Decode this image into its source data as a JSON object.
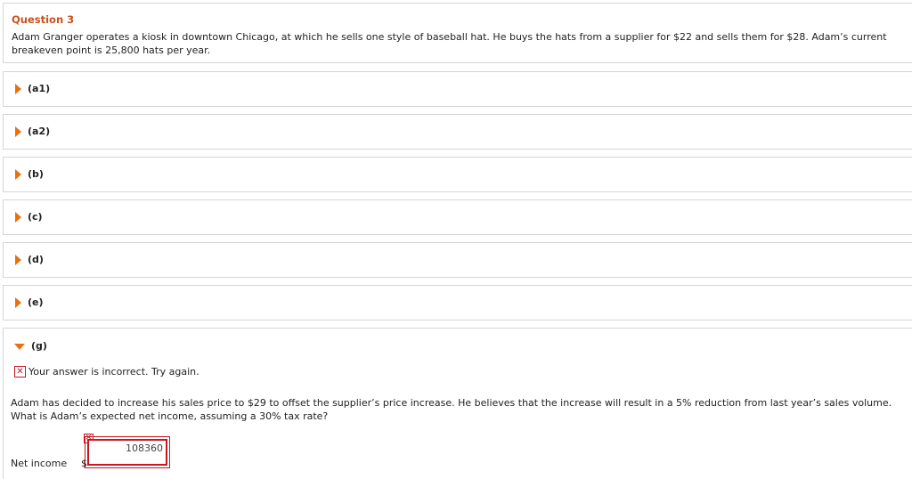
{
  "question": {
    "title": "Question 3",
    "text": "Adam Granger operates a kiosk in downtown Chicago, at which he sells one style of baseball hat. He buys the hats from a supplier for $22 and sells them for $28. Adam’s current breakeven point is 25,800 hats per year."
  },
  "parts": {
    "a1": "(a1)",
    "a2": "(a2)",
    "b": "(b)",
    "c": "(c)",
    "d": "(d)",
    "e": "(e)",
    "g": "(g)"
  },
  "part_g": {
    "feedback": "Your answer is incorrect.  Try again.",
    "text": "Adam has decided to increase his sales price to $29 to offset the supplier’s price increase. He believes that the increase will result in a 5% reduction from last year’s sales volume. What is Adam’s expected net income, assuming a 30% tax rate?",
    "net_income_label": "Net income",
    "currency": "$",
    "answer_value": "108360",
    "incorrect_mark": "✕"
  },
  "icons": {
    "collapsed": "triangle-right-icon",
    "expanded": "triangle-down-icon",
    "incorrect": "incorrect-x-icon"
  },
  "colors": {
    "accent": "#e8710f",
    "title": "#c8511b",
    "error": "#c8161d",
    "border": "#d3d6da"
  }
}
